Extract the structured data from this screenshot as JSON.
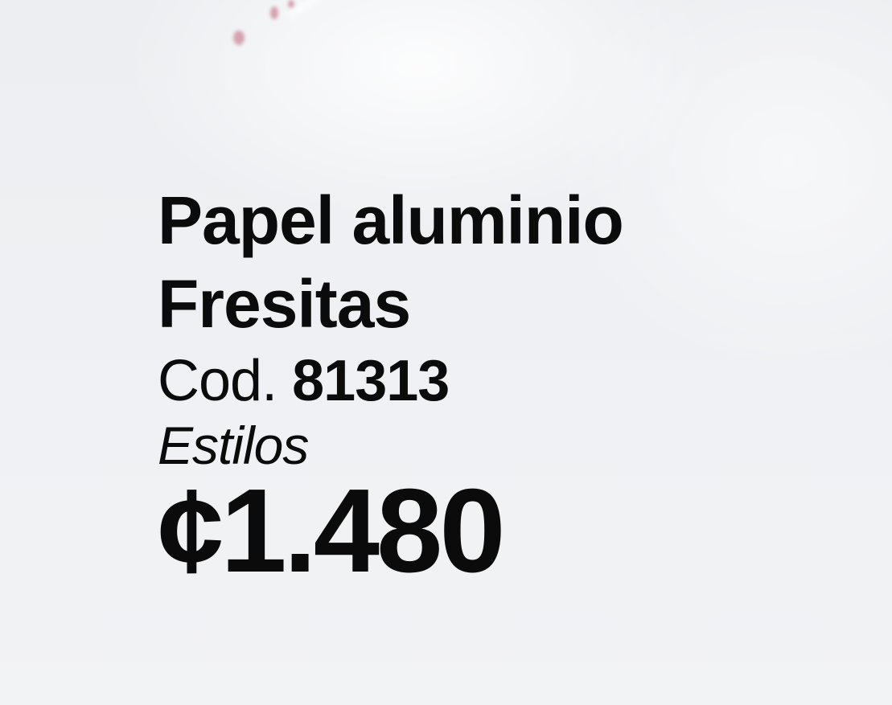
{
  "product": {
    "name_line_1": "Papel aluminio",
    "name_line_2": "Fresitas",
    "code_label": "Cod.",
    "code_value": "81313",
    "brand": "Estilos",
    "price": "¢1.480"
  },
  "colors": {
    "background": "#eff0f2",
    "text": "#0b0b0b",
    "accent_strawberry": "#d6a3b0"
  }
}
